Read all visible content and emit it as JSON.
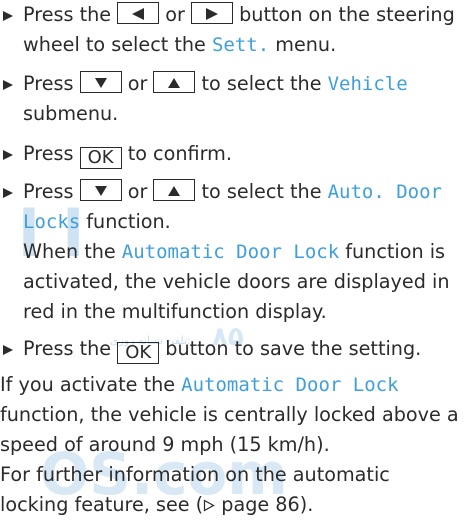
{
  "watermark": {
    "o": "ا ا",
    "num": "۸۵",
    "com": "OS.com",
    "small": "تلفن شبانه روزی:"
  },
  "steps": [
    {
      "a": "Press the ",
      "key1_icon": "left-arrow-icon",
      "b": " or ",
      "key2_icon": "right-arrow-icon",
      "c": " button on the steering wheel to select the ",
      "term": "Sett.",
      "d": " menu."
    },
    {
      "a": "Press ",
      "key1_icon": "down-arrow-icon",
      "b": " or ",
      "key2_icon": "up-arrow-icon",
      "c": " to select the ",
      "term": "Vehicle",
      "d": " submenu."
    },
    {
      "a": "Press ",
      "key_label": "OK",
      "b": " to confirm."
    },
    {
      "a": "Press ",
      "key1_icon": "down-arrow-icon",
      "b": " or ",
      "key2_icon": "up-arrow-icon",
      "c": " to select the ",
      "term": "Auto. Door Locks",
      "d": " function.",
      "note_a": "When the ",
      "note_term": "Automatic Door Lock",
      "note_b": " function is activated, the vehicle doors are displayed in red in the multifunction display."
    },
    {
      "a": "Press the ",
      "key_label": "OK",
      "b": " button to save the setting."
    }
  ],
  "para1": {
    "a": "If you activate the ",
    "term": "Automatic Door Lock",
    "b": " function, the vehicle is centrally locked above a speed of around 9 mph (15 km/h)."
  },
  "para2": {
    "a": "For further information on the automatic locking feature, see (",
    "ref_icon": "triangle-right-outline-icon",
    "b": " page 86)."
  },
  "colors": {
    "text": "#2b2b2b",
    "term": "#3f9fdc",
    "watermark": "#cfe3f3"
  }
}
